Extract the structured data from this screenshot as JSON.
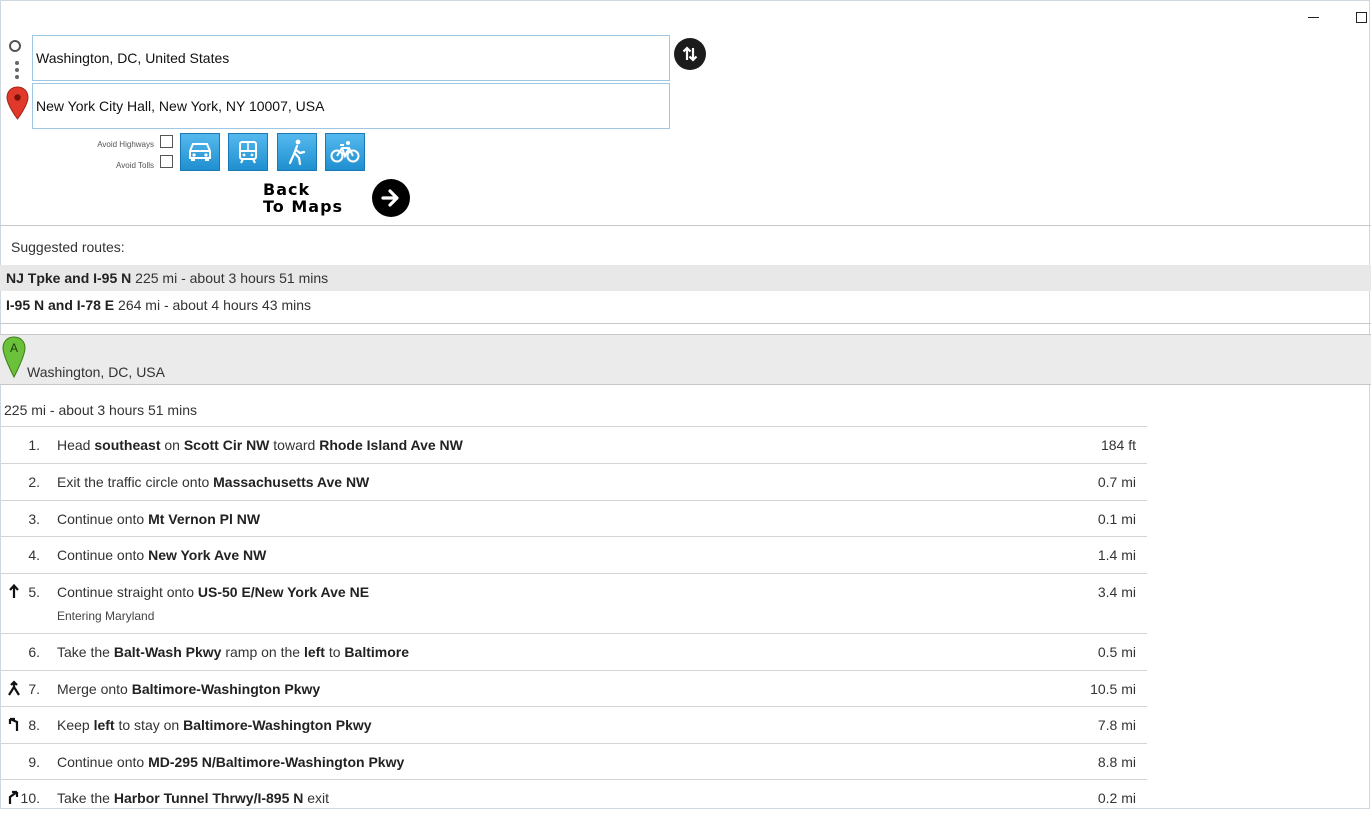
{
  "directions": {
    "from_value": "Washington, DC, United States",
    "to_value": "New York City Hall, New York, NY 10007, USA"
  },
  "options": {
    "avoid_highways": "Avoid Highways",
    "avoid_tolls": "Avoid Tolls"
  },
  "back": {
    "line1": "Back",
    "line2": "To Maps"
  },
  "suggested": {
    "title": "Suggested routes:",
    "routes": [
      {
        "name": "NJ Tpke and I-95 N",
        "detail": " 225 mi - about 3 hours 51 mins"
      },
      {
        "name": "I-95 N and I-78 E",
        "detail": " 264 mi - about 4 hours 43 mins"
      }
    ]
  },
  "start": {
    "marker": "A",
    "address": "Washington, DC, USA"
  },
  "summary": "225 mi - about 3 hours 51 mins",
  "steps": [
    {
      "num": "1.",
      "dist": "184 ft",
      "icon": "",
      "parts": [
        [
          "Head ",
          false
        ],
        [
          "southeast",
          true
        ],
        [
          " on ",
          false
        ],
        [
          "Scott Cir NW",
          true
        ],
        [
          " toward ",
          false
        ],
        [
          "Rhode Island Ave NW",
          true
        ]
      ]
    },
    {
      "num": "2.",
      "dist": "0.7 mi",
      "icon": "",
      "parts": [
        [
          "Exit the traffic circle onto ",
          false
        ],
        [
          "Massachusetts Ave NW",
          true
        ]
      ]
    },
    {
      "num": "3.",
      "dist": "0.1 mi",
      "icon": "",
      "parts": [
        [
          "Continue onto ",
          false
        ],
        [
          "Mt Vernon Pl NW",
          true
        ]
      ]
    },
    {
      "num": "4.",
      "dist": "1.4 mi",
      "icon": "",
      "parts": [
        [
          "Continue onto ",
          false
        ],
        [
          "New York Ave NW",
          true
        ]
      ]
    },
    {
      "num": "5.",
      "dist": "3.4 mi",
      "icon": "straight-arrow-icon",
      "note": "Entering Maryland",
      "parts": [
        [
          "Continue straight onto ",
          false
        ],
        [
          "US-50 E/New York Ave NE",
          true
        ]
      ]
    },
    {
      "num": "6.",
      "dist": "0.5 mi",
      "icon": "",
      "parts": [
        [
          "Take the ",
          false
        ],
        [
          "Balt-Wash Pkwy",
          true
        ],
        [
          " ramp on the ",
          false
        ],
        [
          "left",
          true
        ],
        [
          " to ",
          false
        ],
        [
          "Baltimore",
          true
        ]
      ]
    },
    {
      "num": "7.",
      "dist": "10.5 mi",
      "icon": "merge-icon",
      "parts": [
        [
          "Merge onto ",
          false
        ],
        [
          "Baltimore-Washington Pkwy",
          true
        ]
      ]
    },
    {
      "num": "8.",
      "dist": "7.8 mi",
      "icon": "keep-left-icon",
      "parts": [
        [
          "Keep ",
          false
        ],
        [
          "left",
          true
        ],
        [
          " to stay on ",
          false
        ],
        [
          "Baltimore-Washington Pkwy",
          true
        ]
      ]
    },
    {
      "num": "9.",
      "dist": "8.8 mi",
      "icon": "",
      "parts": [
        [
          "Continue onto ",
          false
        ],
        [
          "MD-295 N/Baltimore-Washington Pkwy",
          true
        ]
      ]
    },
    {
      "num": "10.",
      "dist": "0.2 mi",
      "icon": "ramp-right-icon",
      "parts": [
        [
          "Take the ",
          false
        ],
        [
          "Harbor Tunnel Thrwy/I-895 N",
          true
        ],
        [
          " exit",
          false
        ]
      ]
    }
  ],
  "colors": {
    "mode_button": "#2fa3e0",
    "pin_a": "#6cc13a",
    "pin_dest": "#e0392b",
    "highlight_row": "#e8e8e8"
  }
}
